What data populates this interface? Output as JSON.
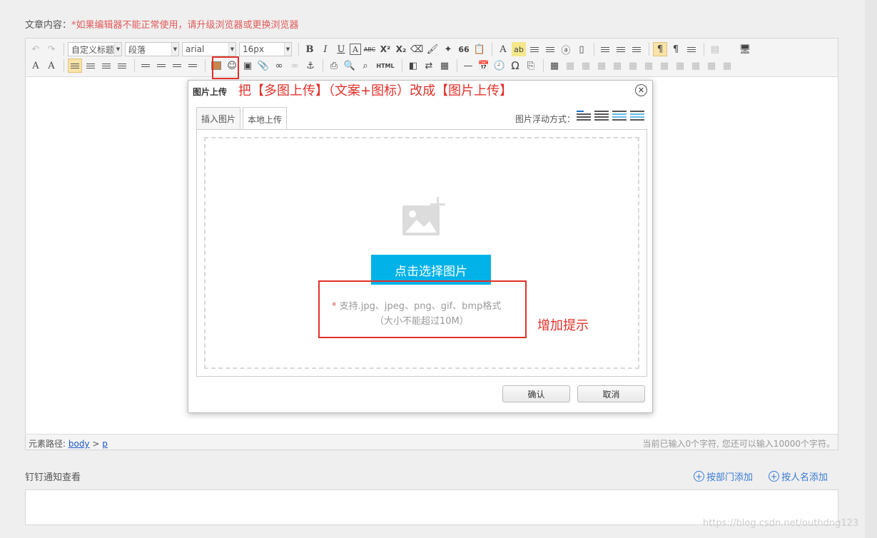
{
  "page": {
    "content_label": "文章内容：",
    "content_warning": "*如果编辑器不能正常使用，请升级浏览器或更换浏览器"
  },
  "toolbar": {
    "custom_title": "自定义标题",
    "paragraph": "段落",
    "font_family": "arial",
    "font_size": "16px",
    "bold": "B",
    "italic": "I",
    "underline": "U",
    "font_border": "A",
    "strike": "ABC",
    "superscript": "X²",
    "subscript": "X₂",
    "quote": "66",
    "font_color": "A",
    "backcolor": "ab",
    "omega": "Ω",
    "html": "HTML"
  },
  "annotations": {
    "note1": "把【多图上传】（文案+图标）改成【图片上传】",
    "note2": "增加提示"
  },
  "dialog": {
    "title": "图片上传",
    "close": "✕",
    "tabs": [
      "插入图片",
      "本地上传"
    ],
    "float_label": "图片浮动方式：",
    "choose_button": "点击选择图片",
    "hint_star": "*",
    "hint_formats": " 支持.jpg、jpeg、png、gif、bmp格式",
    "hint_size": "（大小不能超过10M）",
    "ok": "确认",
    "cancel": "取消"
  },
  "statusbar": {
    "path_label": "元素路径: ",
    "path_body": "body",
    "path_sep": " > ",
    "path_p": "p",
    "char_count": "当前已输入0个字符, 您还可以输入10000个字符。"
  },
  "dingding": {
    "label": "钉钉通知查看",
    "add_dept": "按部门添加",
    "add_name": "按人名添加"
  },
  "watermark": "https://blog.csdn.net/outhdng123"
}
